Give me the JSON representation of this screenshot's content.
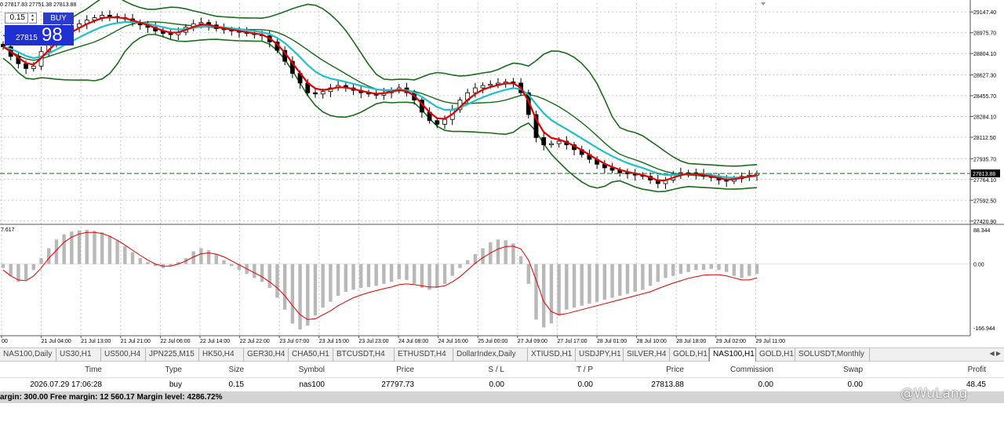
{
  "ohlc_text": "0 27817.83 27751.38 27813.88",
  "trade_panel": {
    "lot": "0.15",
    "buy_label": "BUY",
    "price_small": "27815",
    "price_big": "98"
  },
  "price_axis": {
    "labels": [
      "29147.40",
      "28975.70",
      "28804.10",
      "28627.30",
      "28455.70",
      "28284.10",
      "28112.50",
      "27935.70",
      "27764.10",
      "27592.50",
      "27420.90"
    ],
    "current": "27813.88"
  },
  "indicator_axis": {
    "labels": [
      "88.344",
      "0.00",
      "-166.944"
    ],
    "corner_label": "7.617"
  },
  "time_axis": [
    "00",
    "21 Jul 04:00",
    "21 Jul 13:00",
    "21 Jul 21:00",
    "22 Jul 06:00",
    "22 Jul 14:00",
    "22 Jul 22:00",
    "23 Jul 07:00",
    "23 Jul 15:00",
    "23 Jul 23:00",
    "24 Jul 08:00",
    "24 Jul 16:00",
    "25 Jul 00:00",
    "27 Jul 09:00",
    "27 Jul 17:00",
    "28 Jul 01:00",
    "28 Jul 10:00",
    "28 Jul 18:00",
    "29 Jul 02:00",
    "29 Jul 11:00"
  ],
  "tabs": [
    "NAS100,Daily",
    "US30,H1",
    "US500,H4",
    "JPN225,M15",
    "HK50,H4",
    "GER30,H4",
    "CHA50,H1",
    "BTCUSDT,H4",
    "ETHUSDT,H4",
    "DollarIndex,Daily",
    "XTIUSD,H1",
    "USDJPY,H1",
    "SILVER,H4",
    "GOLD,H1",
    "NAS100,H1",
    "GOLD,H1",
    "SOLUSDT,Monthly"
  ],
  "active_tab": 14,
  "trade_table": {
    "headers": [
      "Time",
      "Type",
      "Size",
      "Symbol",
      "Price",
      "S / L",
      "T / P",
      "Price",
      "Commission",
      "Swap",
      "Profit"
    ],
    "row": [
      "2026.07.29 17:06:28",
      "buy",
      "0.15",
      "nas100",
      "27797.73",
      "0.00",
      "0.00",
      "27813.88",
      "0.00",
      "0.00",
      "48.45"
    ]
  },
  "margin_text": "argin: 300.00  Free margin: 12 560.17  Margin level: 4286.72%",
  "watermark": "@WuLang",
  "colors": {
    "bb": "#1a6b1a",
    "ma_fast": "#e00000",
    "ma_slow": "#20c0c8",
    "hist": "#b8b8b8",
    "signal": "#e00000",
    "buy": "#2a3cc8",
    "grid": "#c8c8c8"
  },
  "chart_data": [
    {
      "type": "candlestick",
      "symbol": "NAS100",
      "timeframe": "H1",
      "ylim": [
        27400,
        29220
      ],
      "close": [
        28860,
        28780,
        28720,
        28680,
        28700,
        28820,
        28900,
        28950,
        28990,
        29020,
        29050,
        29080,
        29100,
        29120,
        29110,
        29100,
        29090,
        29060,
        29040,
        29020,
        28990,
        28970,
        28960,
        28980,
        29020,
        29050,
        29060,
        29040,
        29010,
        29000,
        28990,
        28980,
        28970,
        28960,
        28950,
        28900,
        28830,
        28740,
        28640,
        28560,
        28480,
        28470,
        28490,
        28520,
        28540,
        28520,
        28500,
        28480,
        28470,
        28460,
        28480,
        28500,
        28520,
        28480,
        28420,
        28320,
        28250,
        28220,
        28260,
        28340,
        28420,
        28480,
        28520,
        28540,
        28550,
        28560,
        28570,
        28560,
        28480,
        28300,
        28110,
        28050,
        28060,
        28080,
        28050,
        28010,
        27970,
        27930,
        27890,
        27860,
        27840,
        27820,
        27810,
        27800,
        27790,
        27760,
        27730,
        27760,
        27800,
        27820,
        27820,
        27810,
        27790,
        27780,
        27760,
        27750,
        27770,
        27790,
        27800,
        27813
      ],
      "bollinger_upper_range": [
        28600,
        29200
      ],
      "bollinger_lower_range": [
        27480,
        28900
      ]
    },
    {
      "type": "histogram",
      "name": "",
      "ylim": [
        -166.944,
        88.344
      ],
      "values": [
        -10,
        -30,
        -45,
        -40,
        -15,
        15,
        40,
        62,
        75,
        82,
        85,
        86,
        84,
        80,
        72,
        60,
        45,
        30,
        15,
        5,
        -5,
        -10,
        -5,
        5,
        15,
        32,
        40,
        35,
        25,
        10,
        -5,
        -15,
        -25,
        -35,
        -45,
        -60,
        -85,
        -115,
        -150,
        -165,
        -155,
        -130,
        -110,
        -95,
        -80,
        -70,
        -65,
        -60,
        -58,
        -55,
        -50,
        -45,
        -38,
        -40,
        -50,
        -60,
        -65,
        -60,
        -50,
        -30,
        -10,
        10,
        25,
        40,
        55,
        62,
        60,
        52,
        20,
        -50,
        -140,
        -160,
        -150,
        -130,
        -115,
        -110,
        -105,
        -100,
        -95,
        -90,
        -85,
        -80,
        -75,
        -70,
        -65,
        -55,
        -45,
        -35,
        -30,
        -25,
        -20,
        -15,
        -15,
        -12,
        -15,
        -20,
        -30,
        -35,
        -30,
        -25
      ],
      "signal": [
        -15,
        -30,
        -40,
        -42,
        -30,
        -10,
        15,
        35,
        55,
        68,
        76,
        80,
        80,
        77,
        70,
        60,
        48,
        35,
        22,
        10,
        0,
        -5,
        -5,
        0,
        8,
        18,
        26,
        28,
        25,
        18,
        8,
        -2,
        -12,
        -22,
        -32,
        -45,
        -60,
        -80,
        -105,
        -128,
        -140,
        -138,
        -128,
        -118,
        -105,
        -95,
        -85,
        -78,
        -72,
        -67,
        -62,
        -58,
        -52,
        -50,
        -52,
        -55,
        -58,
        -58,
        -55,
        -45,
        -32,
        -15,
        2,
        16,
        28,
        38,
        44,
        45,
        38,
        10,
        -40,
        -95,
        -120,
        -128,
        -125,
        -120,
        -115,
        -110,
        -105,
        -100,
        -95,
        -90,
        -85,
        -80,
        -75,
        -70,
        -62,
        -55,
        -48,
        -42,
        -36,
        -32,
        -28,
        -27,
        -27,
        -30,
        -35,
        -40,
        -40,
        -35
      ]
    }
  ]
}
